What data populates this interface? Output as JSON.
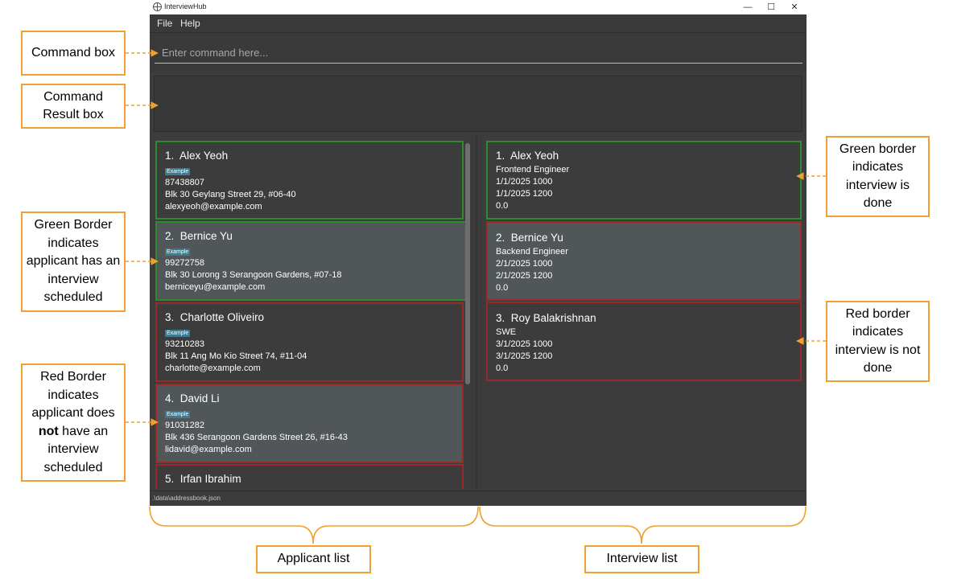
{
  "window": {
    "title": "InterviewHub",
    "controls": [
      "—",
      "☐",
      "✕"
    ]
  },
  "menu": {
    "items": [
      "File",
      "Help"
    ]
  },
  "command": {
    "placeholder": "Enter command here..."
  },
  "applicants": [
    {
      "index": "1.",
      "name": "Alex Yeoh",
      "tag": "Example",
      "phone": "87438807",
      "address": "Blk 30 Geylang Street 29, #06-40",
      "email": "alexyeoh@example.com",
      "scheduled": true
    },
    {
      "index": "2.",
      "name": "Bernice Yu",
      "tag": "Example",
      "phone": "99272758",
      "address": "Blk 30 Lorong 3 Serangoon Gardens, #07-18",
      "email": "berniceyu@example.com",
      "scheduled": true
    },
    {
      "index": "3.",
      "name": "Charlotte Oliveiro",
      "tag": "Example",
      "phone": "93210283",
      "address": "Blk 11 Ang Mo Kio Street 74, #11-04",
      "email": "charlotte@example.com",
      "scheduled": false
    },
    {
      "index": "4.",
      "name": "David Li",
      "tag": "Example",
      "phone": "91031282",
      "address": "Blk 436 Serangoon Gardens Street 26, #16-43",
      "email": "lidavid@example.com",
      "scheduled": false
    },
    {
      "index": "5.",
      "name": "Irfan Ibrahim",
      "tag": "",
      "phone": "",
      "address": "",
      "email": "",
      "scheduled": false
    }
  ],
  "interviews": [
    {
      "index": "1.",
      "name": "Alex Yeoh",
      "role": "Frontend Engineer",
      "start": "1/1/2025 1000",
      "end": "1/1/2025 1200",
      "rating": "0.0",
      "done": true
    },
    {
      "index": "2.",
      "name": "Bernice Yu",
      "role": "Backend Engineer",
      "start": "2/1/2025 1000",
      "end": "2/1/2025 1200",
      "rating": "0.0",
      "done": false
    },
    {
      "index": "3.",
      "name": "Roy Balakrishnan",
      "role": "SWE",
      "start": "3/1/2025 1000",
      "end": "3/1/2025 1200",
      "rating": "0.0",
      "done": false
    }
  ],
  "status": {
    "path": ".\\data\\addressbook.json"
  },
  "annotations": {
    "command_box": "Command box",
    "result_box": "Command Result box",
    "green_applicant": "Green Border indicates applicant has an interview scheduled",
    "red_applicant_pre": "Red Border indicates applicant does ",
    "red_applicant_bold": "not",
    "red_applicant_post": " have an interview scheduled",
    "green_interview": "Green border indicates interview is done",
    "red_interview": "Red border indicates interview is not done",
    "applicant_list": "Applicant list",
    "interview_list": "Interview list"
  },
  "colors": {
    "accent_orange": "#f0a030",
    "green_border": "#2d8a2d",
    "red_border": "#9a2a2a",
    "tag_blue": "#3e7b91",
    "app_background": "#3c3c3c"
  }
}
